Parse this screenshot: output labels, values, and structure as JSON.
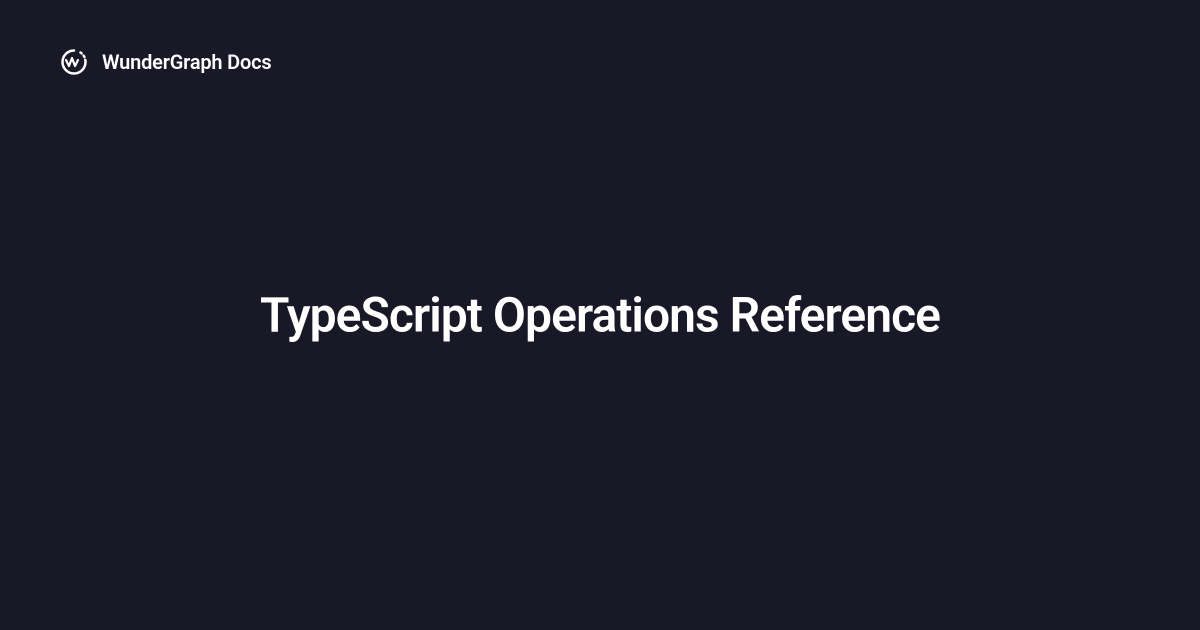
{
  "header": {
    "brand_text": "WunderGraph Docs"
  },
  "main": {
    "title": "TypeScript Operations Reference"
  }
}
